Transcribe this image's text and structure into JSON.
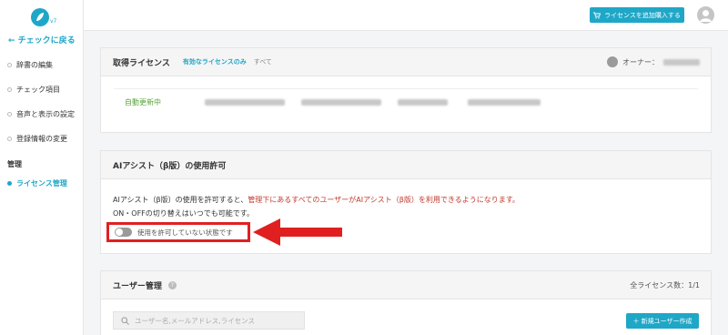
{
  "sidebar": {
    "logo_version": "v7",
    "back_label": "← チェックに戻る",
    "items": [
      {
        "label": "辞書の編集"
      },
      {
        "label": "チェック項目"
      },
      {
        "label": "音声と表示の設定"
      },
      {
        "label": "登録情報の変更"
      }
    ],
    "section_label": "管理",
    "admin_items": [
      {
        "label": "ライセンス管理",
        "active": true
      }
    ]
  },
  "topbar": {
    "add_license_label": "ライセンスを追加購入する"
  },
  "license_card": {
    "title": "取得ライセンス",
    "filter_active": "有効なライセンスのみ",
    "filter_all": "すべて",
    "owner_label": "オーナー：",
    "row_status": "自動更新中"
  },
  "ai_card": {
    "title": "AIアシスト（β版）の使用許可",
    "text_line1_prefix": "AIアシスト（β版）の使用を許可すると、",
    "text_line1_warn": "管理下にあるすべてのユーザーがAIアシスト（β版）を利用できるようになります。",
    "text_line2": "ON・OFFの切り替えはいつでも可能です。",
    "toggle_label": "使用を許可していない状態です",
    "toggle_on": false
  },
  "user_card": {
    "title": "ユーザー管理",
    "help_icon": "?",
    "count_label": "全ライセンス数：1/1",
    "search_placeholder": "ユーザー名,メールアドレス,ライセンス",
    "new_user_label": "＋ 新規ユーザー作成"
  },
  "colors": {
    "accent": "#1fa7c7",
    "warn": "#c0392b",
    "highlight": "#e02020",
    "status_green": "#5aa33a"
  }
}
